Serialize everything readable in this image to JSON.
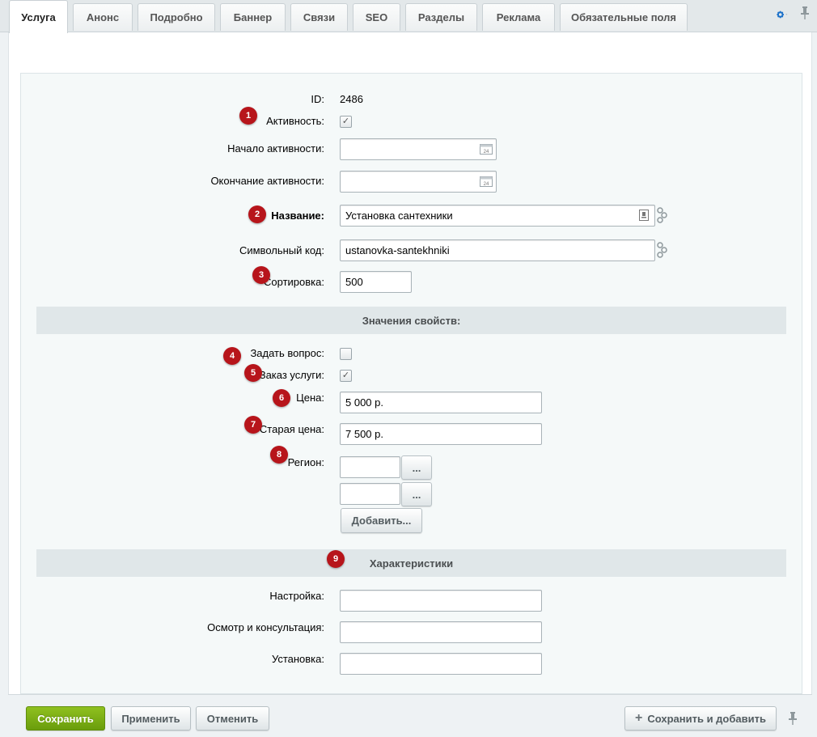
{
  "tabs": [
    {
      "label": "Услуга",
      "active": true
    },
    {
      "label": "Анонс"
    },
    {
      "label": "Подробно"
    },
    {
      "label": "Баннер"
    },
    {
      "label": "Связи"
    },
    {
      "label": "SEO"
    },
    {
      "label": "Разделы"
    },
    {
      "label": "Реклама"
    },
    {
      "label": "Обязательные поля"
    }
  ],
  "form": {
    "id_label": "ID:",
    "id_value": "2486",
    "active_label": "Активность:",
    "active_checked": true,
    "active_from_label": "Начало активности:",
    "active_from_value": "",
    "active_to_label": "Окончание активности:",
    "active_to_value": "",
    "name_label": "Название:",
    "name_value": "Установка сантехники",
    "code_label": "Символьный код:",
    "code_value": "ustanovka-santekhniki",
    "sort_label": "Сортировка:",
    "sort_value": "500"
  },
  "properties": {
    "title": "Значения свойств:",
    "ask_label": "Задать вопрос:",
    "ask_checked": false,
    "order_label": "Заказ услуги:",
    "order_checked": true,
    "price_label": "Цена:",
    "price_value": "5 000 р.",
    "old_price_label": "Старая цена:",
    "old_price_value": "7 500 р.",
    "region_label": "Регион:",
    "region_values": [
      "",
      ""
    ],
    "browse_label": "...",
    "add_label": "Добавить..."
  },
  "characteristics": {
    "title": "Характеристики",
    "setup_label": "Настройка:",
    "setup_value": "",
    "consult_label": "Осмотр и консультация:",
    "consult_value": "",
    "install_label": "Установка:",
    "install_value": ""
  },
  "badges": [
    "1",
    "2",
    "3",
    "4",
    "5",
    "6",
    "7",
    "8",
    "9"
  ],
  "footer": {
    "save": "Сохранить",
    "apply": "Применить",
    "cancel": "Отменить",
    "save_add": "Сохранить и добавить"
  },
  "colors": {
    "badge": "#b7151b",
    "save_button": "#7aae14",
    "settings_icon": "#1b70c9"
  },
  "icons": [
    "settings-gear-icon",
    "pin-icon",
    "calendar-icon",
    "link-translit-icon",
    "plus-icon"
  ]
}
